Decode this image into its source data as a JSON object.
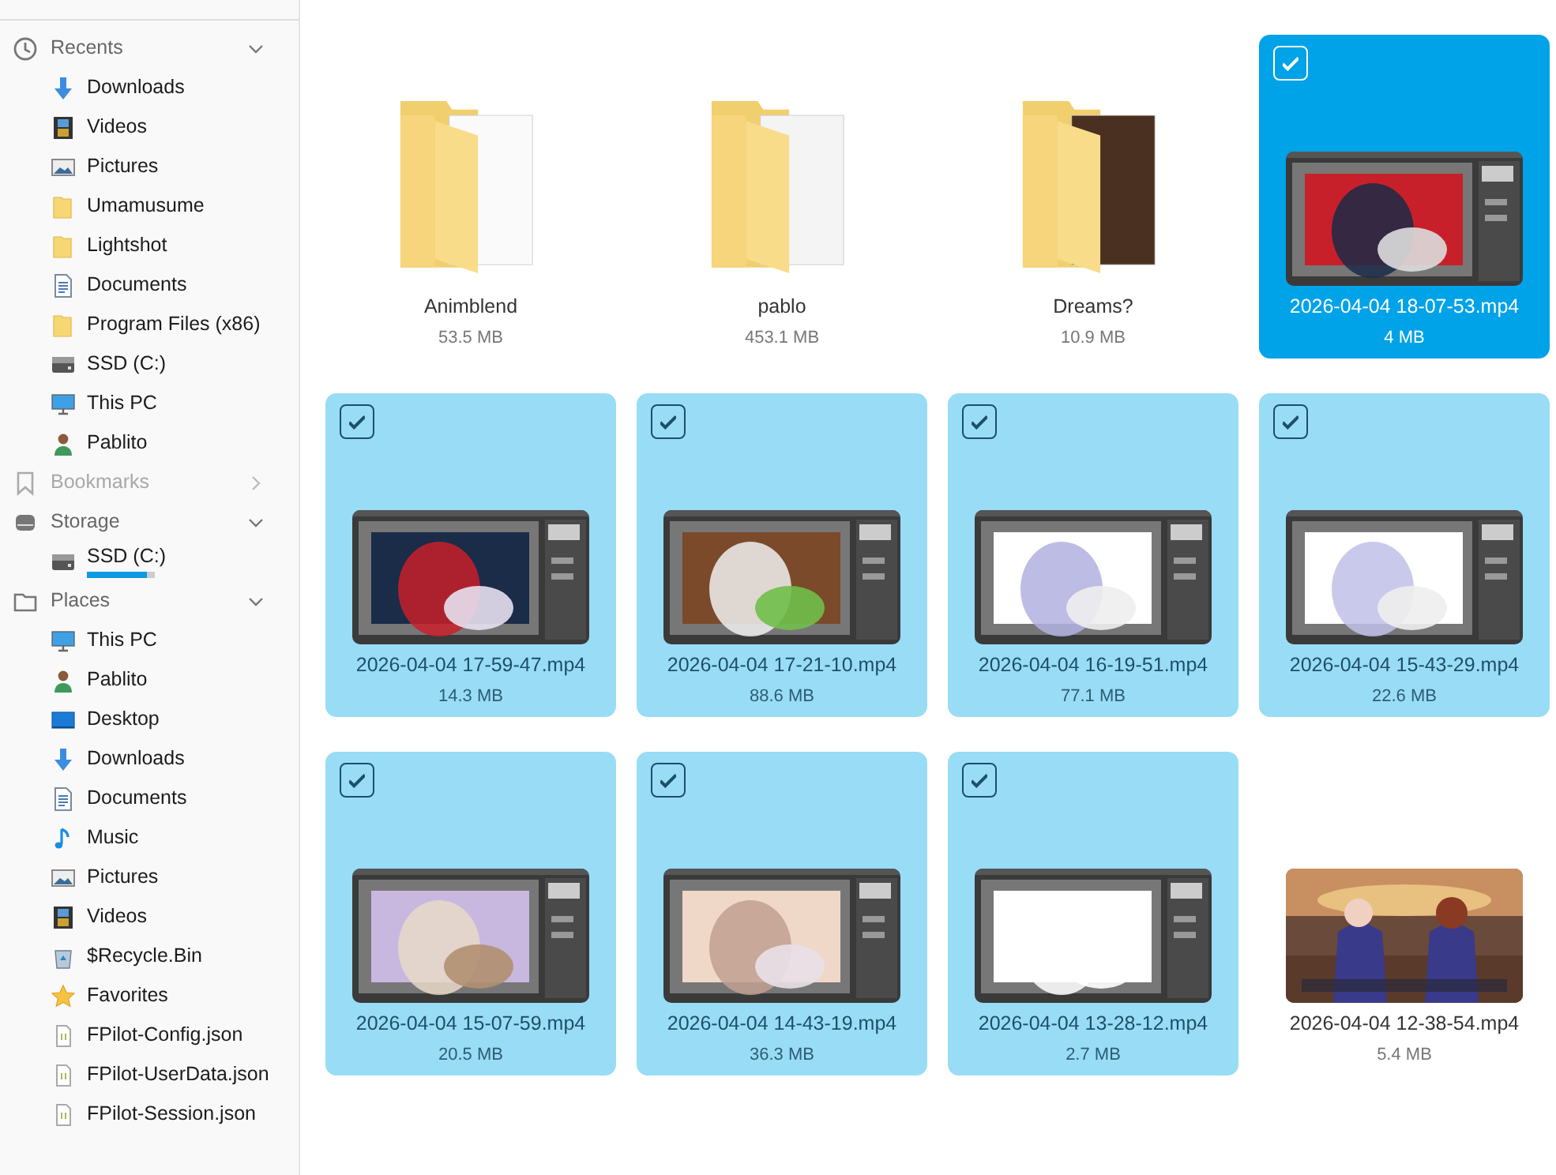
{
  "sidebar": {
    "sections": [
      {
        "label": "Recents",
        "kind": "clock",
        "expanded": true,
        "disabled": false,
        "items": [
          {
            "label": "Downloads",
            "kind": "download"
          },
          {
            "label": "Videos",
            "kind": "video"
          },
          {
            "label": "Pictures",
            "kind": "picture"
          },
          {
            "label": "Umamusume",
            "kind": "folder"
          },
          {
            "label": "Lightshot",
            "kind": "folder"
          },
          {
            "label": "Documents",
            "kind": "document"
          },
          {
            "label": "Program Files (x86)",
            "kind": "folder"
          },
          {
            "label": "SSD (C:)",
            "kind": "drive"
          },
          {
            "label": "This PC",
            "kind": "pc"
          },
          {
            "label": "Pablito",
            "kind": "user"
          }
        ]
      },
      {
        "label": "Bookmarks",
        "kind": "bookmark",
        "expanded": false,
        "disabled": true
      },
      {
        "label": "Storage",
        "kind": "storage",
        "expanded": true,
        "disabled": false,
        "items": [
          {
            "label": "SSD (C:)",
            "kind": "drive",
            "level": 0.88
          }
        ]
      },
      {
        "label": "Places",
        "kind": "places",
        "expanded": true,
        "disabled": false,
        "items": [
          {
            "label": "This PC",
            "kind": "pc"
          },
          {
            "label": "Pablito",
            "kind": "user"
          },
          {
            "label": "Desktop",
            "kind": "desktop"
          },
          {
            "label": "Downloads",
            "kind": "download"
          },
          {
            "label": "Documents",
            "kind": "document"
          },
          {
            "label": "Music",
            "kind": "music"
          },
          {
            "label": "Pictures",
            "kind": "picture"
          },
          {
            "label": "Videos",
            "kind": "video"
          },
          {
            "label": "$Recycle.Bin",
            "kind": "recycle"
          },
          {
            "label": "Favorites",
            "kind": "star"
          },
          {
            "label": "FPilot-Config.json",
            "kind": "json"
          },
          {
            "label": "FPilot-UserData.json",
            "kind": "json"
          },
          {
            "label": "FPilot-Session.json",
            "kind": "json"
          }
        ]
      }
    ]
  },
  "files": [
    {
      "name": "Animblend",
      "size": "53.5 MB",
      "kind": "folder",
      "selected": false,
      "focused": false
    },
    {
      "name": "pablo",
      "size": "453.1 MB",
      "kind": "folder",
      "selected": false,
      "focused": false
    },
    {
      "name": "Dreams?",
      "size": "10.9 MB",
      "kind": "folder",
      "selected": false,
      "focused": false
    },
    {
      "name": "2026-04-04 18-07-53.mp4",
      "size": "4 MB",
      "kind": "video",
      "selected": true,
      "focused": true
    },
    {
      "name": "2026-04-04 17-59-47.mp4",
      "size": "14.3 MB",
      "kind": "video",
      "selected": true,
      "focused": false
    },
    {
      "name": "2026-04-04 17-21-10.mp4",
      "size": "88.6 MB",
      "kind": "video",
      "selected": true,
      "focused": false
    },
    {
      "name": "2026-04-04 16-19-51.mp4",
      "size": "77.1 MB",
      "kind": "video",
      "selected": true,
      "focused": false
    },
    {
      "name": "2026-04-04 15-43-29.mp4",
      "size": "22.6 MB",
      "kind": "video",
      "selected": true,
      "focused": false
    },
    {
      "name": "2026-04-04 15-07-59.mp4",
      "size": "20.5 MB",
      "kind": "video",
      "selected": true,
      "focused": false
    },
    {
      "name": "2026-04-04 14-43-19.mp4",
      "size": "36.3 MB",
      "kind": "video",
      "selected": true,
      "focused": false
    },
    {
      "name": "2026-04-04 13-28-12.mp4",
      "size": "2.7 MB",
      "kind": "video",
      "selected": true,
      "focused": false
    },
    {
      "name": "2026-04-04 12-38-54.mp4",
      "size": "5.4 MB",
      "kind": "video",
      "selected": false,
      "focused": false
    }
  ]
}
